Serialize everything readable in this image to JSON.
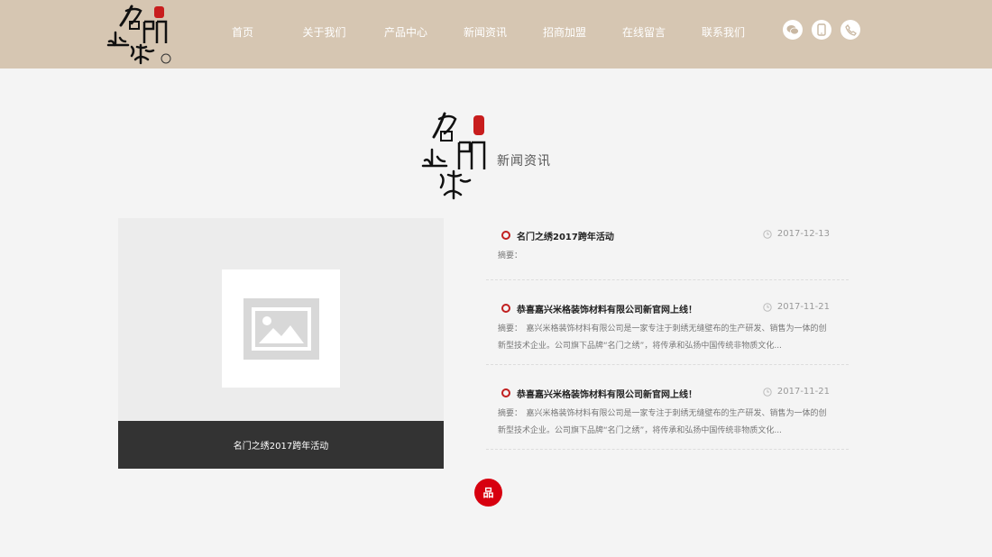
{
  "header": {
    "brand_trademark": "®",
    "logo_text": "名門繡",
    "nav": [
      {
        "label": "首页"
      },
      {
        "label": "关于我们"
      },
      {
        "label": "产品中心"
      },
      {
        "label": "新闻资讯"
      },
      {
        "label": "招商加盟"
      },
      {
        "label": "在线留言"
      },
      {
        "label": "联系我们"
      }
    ],
    "icons": [
      "wechat-icon",
      "mobile-icon",
      "phone-icon"
    ]
  },
  "section": {
    "title": "新闻资讯"
  },
  "featured": {
    "caption": "名门之绣2017跨年活动"
  },
  "news": [
    {
      "title": "名门之绣2017跨年活动",
      "date": "2017-12-13",
      "summary": "摘要："
    },
    {
      "title": "恭喜嘉兴米格装饰材料有限公司新官网上线！",
      "date": "2017-11-21",
      "summary": "摘要：　嘉兴米格装饰材料有限公司是一家专注于刺绣无缝壁布的生产研发、销售为一体的创新型技术企业。公司旗下品牌“名门之绣”，将传承和弘扬中国传统非物质文化..."
    },
    {
      "title": "恭喜嘉兴米格装饰材料有限公司新官网上线！",
      "date": "2017-11-21",
      "summary": "摘要：　嘉兴米格装饰材料有限公司是一家专注于刺绣无缝壁布的生产研发、销售为一体的创新型技术企业。公司旗下品牌“名门之绣”，将传承和弘扬中国传统非物质文化..."
    }
  ],
  "float_button": {
    "label": "品"
  },
  "colors": {
    "header_bg": "#d6c6b2",
    "accent_red": "#c11f1f",
    "caption_bg": "#333333"
  }
}
